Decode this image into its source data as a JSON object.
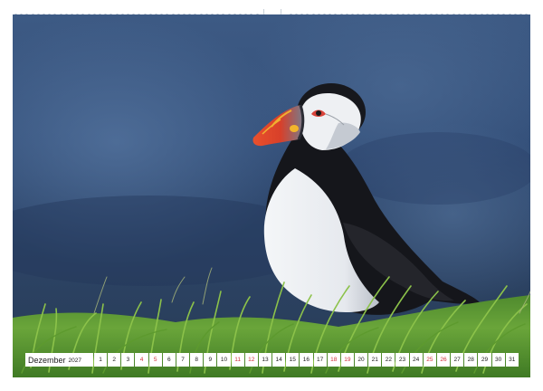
{
  "calendar": {
    "month": "Dezember",
    "year": "2027",
    "days": [
      {
        "day": "1",
        "red": false
      },
      {
        "day": "2",
        "red": false
      },
      {
        "day": "3",
        "red": false
      },
      {
        "day": "4",
        "red": true
      },
      {
        "day": "5",
        "red": true
      },
      {
        "day": "6",
        "red": false
      },
      {
        "day": "7",
        "red": false
      },
      {
        "day": "8",
        "red": false
      },
      {
        "day": "9",
        "red": false
      },
      {
        "day": "10",
        "red": false
      },
      {
        "day": "11",
        "red": true
      },
      {
        "day": "12",
        "red": true
      },
      {
        "day": "13",
        "red": false
      },
      {
        "day": "14",
        "red": false
      },
      {
        "day": "15",
        "red": false
      },
      {
        "day": "16",
        "red": false
      },
      {
        "day": "17",
        "red": false
      },
      {
        "day": "18",
        "red": true
      },
      {
        "day": "19",
        "red": true
      },
      {
        "day": "20",
        "red": false
      },
      {
        "day": "21",
        "red": false
      },
      {
        "day": "22",
        "red": false
      },
      {
        "day": "23",
        "red": false
      },
      {
        "day": "24",
        "red": false
      },
      {
        "day": "25",
        "red": true
      },
      {
        "day": "26",
        "red": true
      },
      {
        "day": "27",
        "red": false
      },
      {
        "day": "28",
        "red": false
      },
      {
        "day": "29",
        "red": false
      },
      {
        "day": "30",
        "red": false
      },
      {
        "day": "31",
        "red": false
      }
    ]
  },
  "photo": {
    "subject": "puffin-on-grass",
    "colors": {
      "background_blue": "#3f5d86",
      "grass": "#6fa53a",
      "beak_red": "#e04a2c",
      "beak_yellow": "#f0b830",
      "plumage_black": "#15161b"
    }
  },
  "colors": {
    "weekend_red": "#d0303a",
    "binding": "#b9c3cf"
  }
}
